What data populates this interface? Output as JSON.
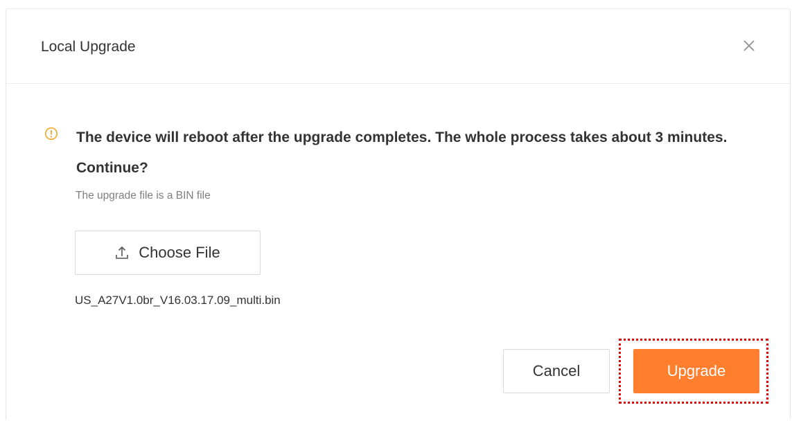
{
  "dialog": {
    "title": "Local Upgrade",
    "close_icon": "close-icon"
  },
  "body": {
    "warning_icon": "exclamation-circle-icon",
    "warning_text": "The device will reboot after the upgrade completes. The whole process takes about 3 minutes. Continue?",
    "hint": "The upgrade file is a BIN file",
    "choose_file": {
      "icon": "upload-icon",
      "label": "Choose File"
    },
    "selected_file": "US_A27V1.0br_V16.03.17.09_multi.bin"
  },
  "footer": {
    "cancel_label": "Cancel",
    "upgrade_label": "Upgrade"
  },
  "colors": {
    "accent": "#ff7f2e",
    "warning": "#f5a623",
    "highlight": "#e00000"
  }
}
